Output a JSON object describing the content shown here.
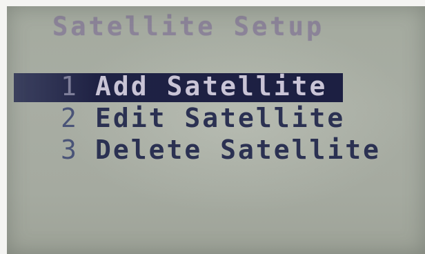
{
  "screen": {
    "title": "Satellite Setup"
  },
  "menu": {
    "items": [
      {
        "number": "1",
        "label": "Add Satellite",
        "selected": true
      },
      {
        "number": "2",
        "label": "Edit Satellite",
        "selected": false
      },
      {
        "number": "3",
        "label": "Delete Satellite",
        "selected": false
      }
    ]
  },
  "colors": {
    "lcd_background": "#a6aba1",
    "text": "#2b3152",
    "title_text": "#8b8398",
    "highlight": "#1f2244",
    "highlight_text": "#c9c4d6"
  }
}
